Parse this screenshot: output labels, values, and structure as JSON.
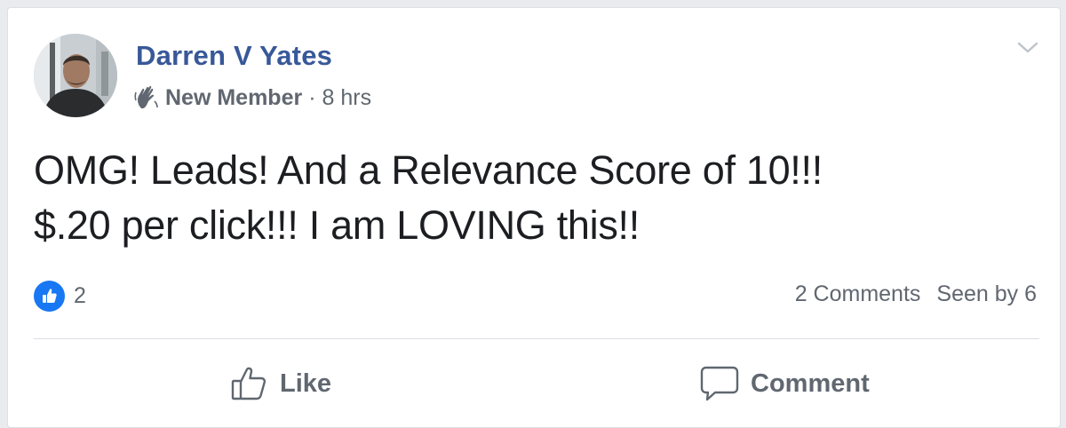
{
  "post": {
    "author": "Darren V Yates",
    "badge_icon": "wave-icon",
    "badge": "New Member",
    "separator": "·",
    "time": "8 hrs",
    "text_lines": [
      "OMG! Leads! And a Relevance Score of 10!!!",
      "$.20 per click!!! I am LOVING this!!"
    ],
    "reactions": {
      "icon": "like-icon",
      "count": "2",
      "color": "#1877f2"
    },
    "comments": "2 Comments",
    "seen_by": "Seen by 6"
  },
  "actions": {
    "like_label": "Like",
    "like_icon": "thumbs-up-icon",
    "comment_label": "Comment",
    "comment_icon": "speech-bubble-icon"
  },
  "colors": {
    "author": "#385898",
    "secondary_text": "#606770",
    "body_text": "#1c1e21"
  }
}
